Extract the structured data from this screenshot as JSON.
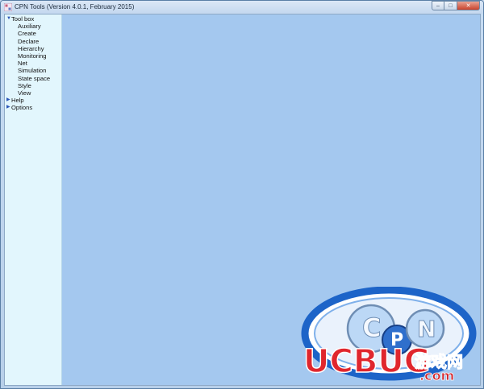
{
  "window": {
    "title": "CPN Tools (Version 4.0.1, February 2015)",
    "controls": {
      "minimize": "–",
      "maximize": "□",
      "close": "✕"
    }
  },
  "sidebar": {
    "tool_box": {
      "label": "Tool box",
      "expanded": true,
      "items": [
        "Auxiliary",
        "Create",
        "Declare",
        "Hierarchy",
        "Monitoring",
        "Net",
        "Simulation",
        "State space",
        "Style",
        "View"
      ]
    },
    "help": {
      "label": "Help",
      "expanded": false
    },
    "options": {
      "label": "Options",
      "expanded": false
    }
  },
  "watermark": {
    "letters": [
      "C",
      "P",
      "N"
    ],
    "brand": "UCBUG",
    "cn": "游戏网",
    "domain": ".com"
  },
  "colors": {
    "sidebar_bg": "#e2f6fd",
    "workspace_bg": "#a4c8ef",
    "tree_triangle": "#2b56b8"
  }
}
